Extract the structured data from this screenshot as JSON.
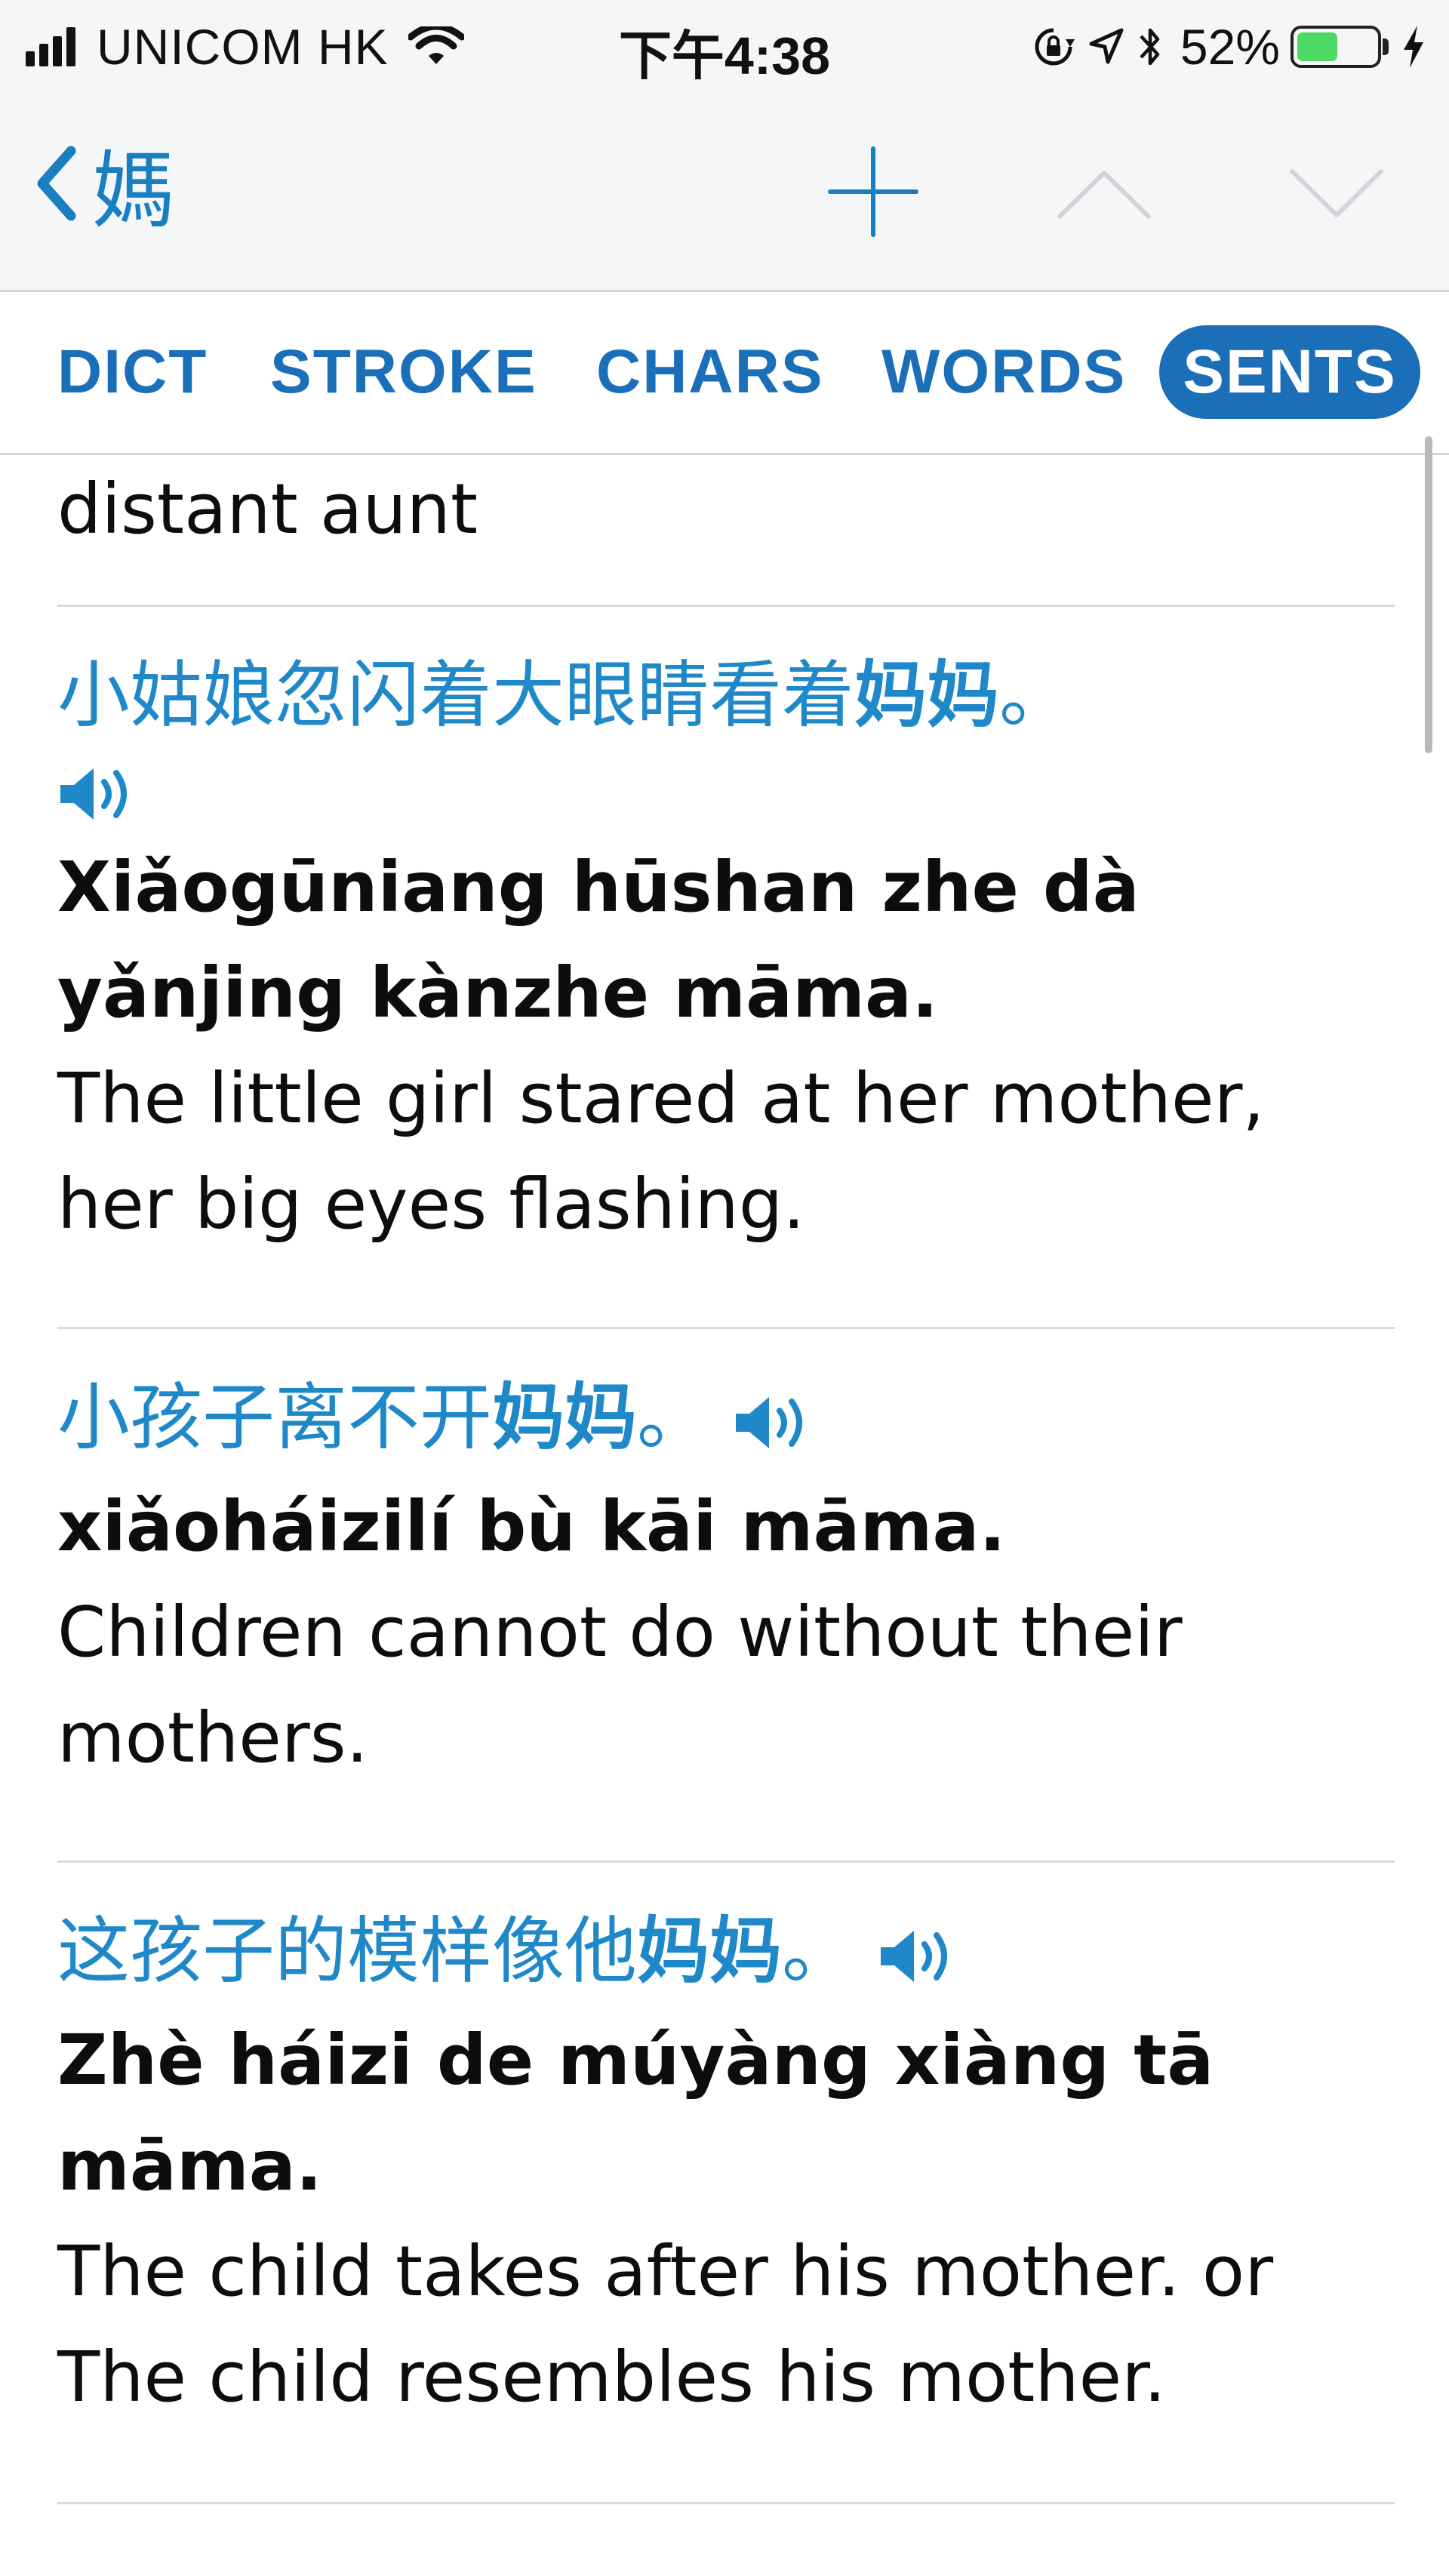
{
  "status_bar": {
    "carrier": "UNICOM HK",
    "time": "下午4:38",
    "battery_percent_text": "52%",
    "battery_level": 0.52,
    "battery_color": "#4cd964",
    "icons": [
      "signal-icon",
      "wifi-icon",
      "orientation-lock-icon",
      "location-icon",
      "bluetooth-icon",
      "battery-icon",
      "charging-bolt-icon"
    ]
  },
  "navbar": {
    "back_title": "媽",
    "icons": [
      "chevron-left-icon",
      "plus-icon",
      "chevron-up-icon",
      "chevron-down-icon"
    ],
    "accent_color": "#1a7fc1"
  },
  "tabs": [
    {
      "label": "DICT",
      "active": false
    },
    {
      "label": "STROKE",
      "active": false
    },
    {
      "label": "CHARS",
      "active": false
    },
    {
      "label": "WORDS",
      "active": false
    },
    {
      "label": "SENTS",
      "active": true
    }
  ],
  "entries": [
    {
      "english": "distant aunt"
    },
    {
      "chinese_pre": "小姑娘忽闪着大眼睛看着",
      "chinese_highlight": "妈妈",
      "chinese_post": "。",
      "pinyin_lines": [
        "Xiǎogūniang hūshan zhe dà",
        "yǎnjing kànzhe māma."
      ],
      "english_lines": [
        "The little girl stared at her mother,",
        "her big eyes flashing."
      ]
    },
    {
      "chinese_pre": "小孩子离不开",
      "chinese_highlight": "妈妈",
      "chinese_post": "。",
      "pinyin_lines": [
        "xiǎoháizilí bù kāi māma."
      ],
      "english_lines": [
        "Children cannot do without their",
        "mothers."
      ]
    },
    {
      "chinese_pre": "这孩子的模样像他",
      "chinese_highlight": "妈妈",
      "chinese_post": "。",
      "pinyin_lines": [
        "Zhè háizi de múyàng xiàng tā",
        "māma."
      ],
      "english_lines": [
        "The child takes after his mother. or",
        "The child resembles his mother."
      ]
    }
  ]
}
